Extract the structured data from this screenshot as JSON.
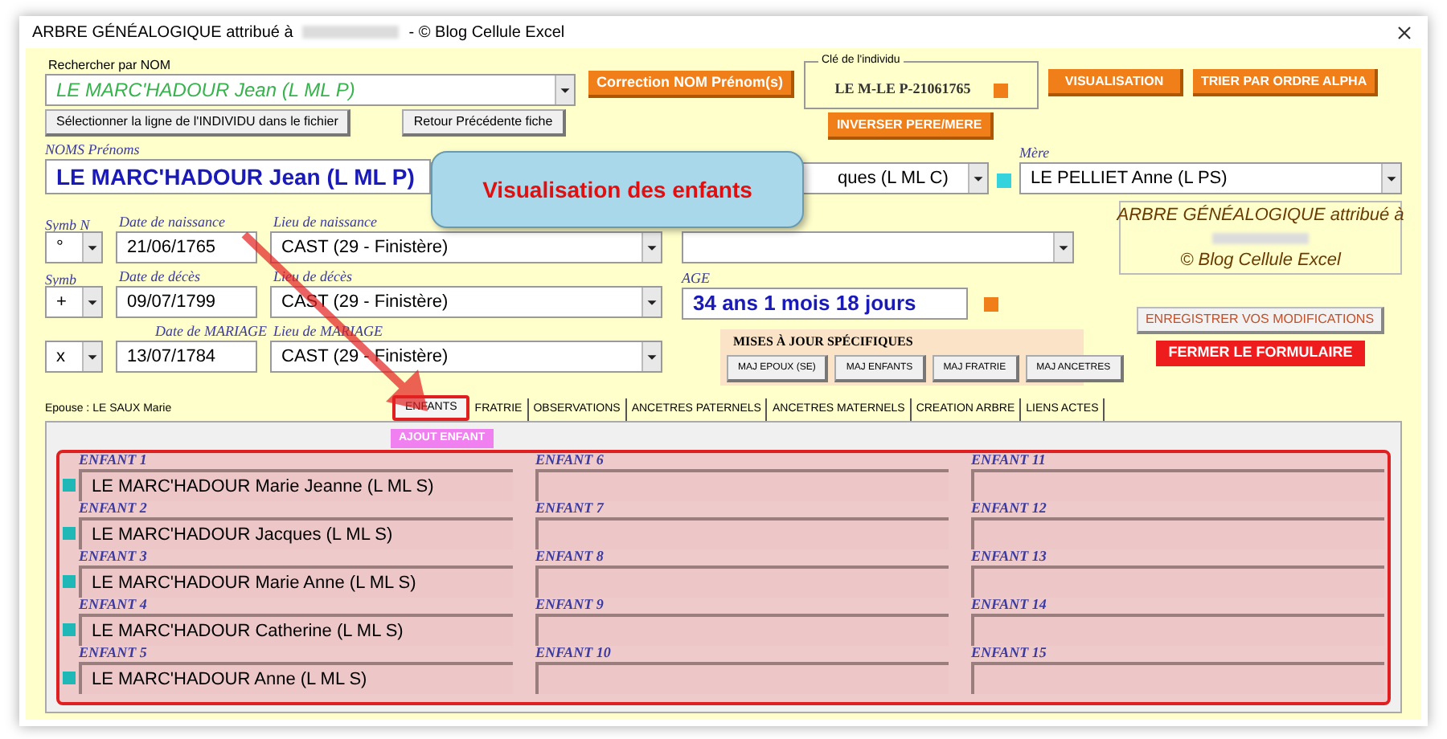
{
  "window": {
    "title_start": "ARBRE GÉNÉALOGIQUE attribué à",
    "title_end": "- © Blog Cellule Excel"
  },
  "search": {
    "label": "Rechercher par NOM",
    "value": "LE MARC'HADOUR Jean  (L ML P)"
  },
  "correction_button": "Correction NOM Prénom(s)",
  "key": {
    "label": "Clé de l'individu",
    "value": "LE M-LE P-21061765"
  },
  "visualisation_button": "VISUALISATION",
  "sort_button": "TRIER PAR ORDRE ALPHA",
  "select_row_button": "Sélectionner la ligne de l'INDIVIDU  dans le fichier",
  "back_button": "Retour Précédente fiche",
  "swap_button": "INVERSER PERE/MERE",
  "name": {
    "label": "NOMS Prénoms",
    "value": "LE MARC'HADOUR Jean  (L ML P)"
  },
  "father": {
    "value": "ques (L ML C)"
  },
  "mother": {
    "label": "Mère",
    "value": "LE PELLIET Anne (L PS)"
  },
  "events": [
    {
      "symbol_label": "Symb N",
      "symbol": "°",
      "date_label": "Date de naissance",
      "date": "21/06/1765",
      "place_label": "Lieu de naissance",
      "place": "CAST (29 - Finistère)"
    },
    {
      "symbol_label": "Symb",
      "symbol": "+",
      "date_label": "Date de décès",
      "date": "09/07/1799",
      "place_label": "Lieu de décès",
      "place": "CAST (29 - Finistère)"
    },
    {
      "symbol": "x",
      "date_label": "Date de MARIAGE",
      "date": "13/07/1784",
      "place_label": "Lieu de MARIAGE",
      "place": "CAST (29 - Finistère)"
    }
  ],
  "signature": {
    "line_1": "ARBRE GÉNÉALOGIQUE attribué à",
    "line_2": "© Blog Cellule Excel"
  },
  "age": {
    "label": "AGE",
    "value": "34 ans 1 mois 18 jours"
  },
  "updates": {
    "title": "MISES À JOUR SPÉCIFIQUES",
    "buttons": [
      "MAJ EPOUX (SE)",
      "MAJ ENFANTS",
      "MAJ FRATRIE",
      "MAJ ANCETRES"
    ]
  },
  "save_button": "ENREGISTRER VOS MODIFICATIONS",
  "close_button": "FERMER LE FORMULAIRE",
  "spouse": "Epouse : LE SAUX Marie",
  "tabs": [
    {
      "label": "ENFANTS",
      "selected": true
    },
    {
      "label": "FRATRIE",
      "selected": false
    },
    {
      "label": "OBSERVATIONS",
      "selected": false
    },
    {
      "label": "ANCETRES PATERNELS",
      "selected": false
    },
    {
      "label": "ANCETRES MATERNELS",
      "selected": false
    },
    {
      "label": "CREATION ARBRE",
      "selected": false
    },
    {
      "label": "LIENS ACTES",
      "selected": false
    }
  ],
  "add_child_button": "AJOUT ENFANT",
  "callout": "Visualisation des enfants",
  "children": [
    {
      "label": "ENFANT 1",
      "value": "LE MARC'HADOUR  Marie Jeanne (L ML S)",
      "linked": true
    },
    {
      "label": "ENFANT 2",
      "value": "LE MARC'HADOUR  Jacques (L ML S)",
      "linked": true
    },
    {
      "label": "ENFANT 3",
      "value": "LE MARC'HADOUR  Marie Anne (L ML S)",
      "linked": true
    },
    {
      "label": "ENFANT 4",
      "value": "LE MARC'HADOUR  Catherine (L ML S)",
      "linked": true
    },
    {
      "label": "ENFANT 5",
      "value": "LE MARC'HADOUR  Anne (L ML S)",
      "linked": true
    },
    {
      "label": "ENFANT 6",
      "linked": false
    },
    {
      "label": "ENFANT 7",
      "linked": false
    },
    {
      "label": "ENFANT 8",
      "linked": false
    },
    {
      "label": "ENFANT 9",
      "linked": false
    },
    {
      "label": "ENFANT 10",
      "linked": false
    },
    {
      "label": "ENFANT 11",
      "linked": false
    },
    {
      "label": "ENFANT 12",
      "linked": false
    },
    {
      "label": "ENFANT 13",
      "linked": false
    },
    {
      "label": "ENFANT 14",
      "linked": false
    },
    {
      "label": "ENFANT 15",
      "linked": false
    }
  ]
}
